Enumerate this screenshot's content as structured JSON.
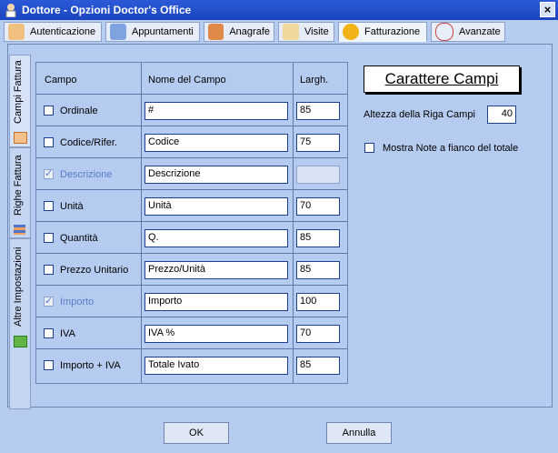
{
  "window": {
    "title": "Dottore - Opzioni Doctor's Office",
    "close_glyph": "×"
  },
  "tabs": [
    {
      "label": "Autenticazione",
      "icon": "user-key-icon"
    },
    {
      "label": "Appuntamenti",
      "icon": "calendar-icon"
    },
    {
      "label": "Anagrafe",
      "icon": "people-icon"
    },
    {
      "label": "Visite",
      "icon": "clipboard-icon"
    },
    {
      "label": "Fatturazione",
      "icon": "euro-coin-icon",
      "active": true
    },
    {
      "label": "Avanzate",
      "icon": "settings-face-icon"
    }
  ],
  "side_tabs": [
    {
      "label": "Campi Fattura",
      "icon": "table-icon",
      "active": true
    },
    {
      "label": "Righe Fattura",
      "icon": "rows-icon"
    },
    {
      "label": "Altre Impostazioni",
      "icon": "plus-icon"
    }
  ],
  "grid": {
    "headers": [
      "Campo",
      "Nome del Campo",
      "Largh."
    ],
    "rows": [
      {
        "field": "Ordinale",
        "name": "#",
        "width": "85",
        "checked": false,
        "disabled": false
      },
      {
        "field": "Codice/Rifer.",
        "name": "Codice",
        "width": "75",
        "checked": false,
        "disabled": false
      },
      {
        "field": "Descrizione",
        "name": "Descrizione",
        "width": "",
        "checked": true,
        "disabled": true
      },
      {
        "field": "Unità",
        "name": "Unità",
        "width": "70",
        "checked": false,
        "disabled": false
      },
      {
        "field": "Quantità",
        "name": "Q.",
        "width": "85",
        "checked": false,
        "disabled": false
      },
      {
        "field": "Prezzo Unitario",
        "name": "Prezzo/Unità",
        "width": "85",
        "checked": false,
        "disabled": false
      },
      {
        "field": "Importo",
        "name": "Importo",
        "width": "100",
        "checked": true,
        "disabled": true
      },
      {
        "field": "IVA",
        "name": "IVA %",
        "width": "70",
        "checked": false,
        "disabled": false
      },
      {
        "field": "Importo + IVA",
        "name": "Totale Ivato",
        "width": "85",
        "checked": false,
        "disabled": false
      }
    ]
  },
  "options": {
    "font_button": "Carattere Campi",
    "row_height_label": "Altezza della Riga Campi",
    "row_height_value": "40",
    "notes_label": "Mostra Note a fianco del totale",
    "notes_checked": false
  },
  "footer": {
    "ok": "OK",
    "cancel": "Annulla"
  }
}
